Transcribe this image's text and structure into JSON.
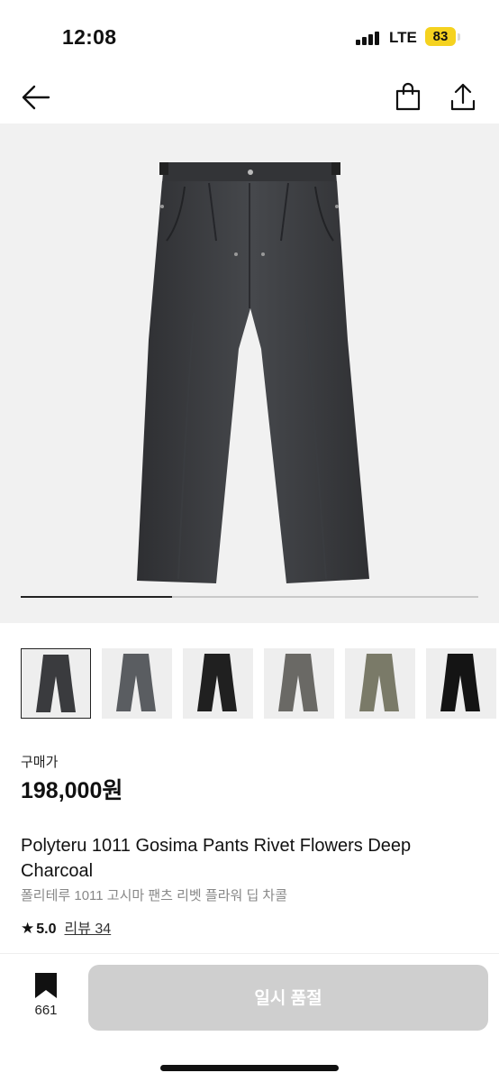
{
  "status": {
    "time": "12:08",
    "network": "LTE",
    "battery": "83"
  },
  "colors": {
    "accent_battery": "#f5d21f",
    "disabled_button": "#cfcfcf"
  },
  "nav": {
    "back_icon": "arrow-left-icon",
    "cart_icon": "shopping-bag-icon",
    "share_icon": "share-icon"
  },
  "gallery": {
    "progress": 0.33
  },
  "thumbnails": [
    {
      "name": "deep-charcoal",
      "color": "#3a3b3e",
      "selected": true
    },
    {
      "name": "grey",
      "color": "#5a5d61",
      "selected": false
    },
    {
      "name": "black-washed",
      "color": "#202020",
      "selected": false
    },
    {
      "name": "warm-grey",
      "color": "#6a6965",
      "selected": false
    },
    {
      "name": "olive",
      "color": "#7a7a68",
      "selected": false
    },
    {
      "name": "black",
      "color": "#141414",
      "selected": false
    }
  ],
  "product": {
    "price_label": "구매가",
    "price": "198,000원",
    "title_en": "Polyteru 1011 Gosima Pants Rivet Flowers Deep Charcoal",
    "title_ko": "폴리테루 1011 고시마 팬츠 리벳 플라워 딥 차콜",
    "rating": "5.0",
    "reviews": "리뷰 34"
  },
  "footer": {
    "bookmark_count": "661",
    "buy_label": "일시 품절"
  }
}
